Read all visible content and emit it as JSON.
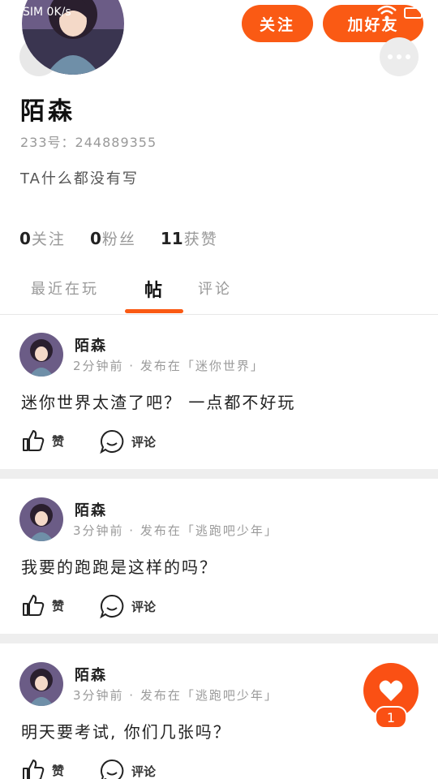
{
  "status_bar": {
    "left_text": "SIM 0K/s"
  },
  "header": {
    "follow_label": "关注",
    "add_friend_label": "加好友"
  },
  "profile": {
    "name": "陌森",
    "id_label": "233号：",
    "id_value": "244889355",
    "bio": "TA什么都没有写",
    "stats": [
      {
        "value": "0",
        "label": "关注"
      },
      {
        "value": "0",
        "label": "粉丝"
      },
      {
        "value": "11",
        "label": "获赞"
      }
    ]
  },
  "tabs": [
    {
      "label": "最近在玩",
      "active": false
    },
    {
      "label": "帖",
      "active": true
    },
    {
      "label": "评论",
      "active": false
    }
  ],
  "posts": [
    {
      "author": "陌森",
      "meta": "2分钟前 · 发布在「迷你世界」",
      "text": "迷你世界太渣了吧？ 一点都不好玩",
      "like_label": "赞",
      "comment_label": "评论"
    },
    {
      "author": "陌森",
      "meta": "3分钟前 · 发布在「逃跑吧少年」",
      "text": "我要的跑跑是这样的吗？",
      "like_label": "赞",
      "comment_label": "评论"
    },
    {
      "author": "陌森",
      "meta": "3分钟前 · 发布在「逃跑吧少年」",
      "text": "明天要考试, 你们几张吗？",
      "like_label": "赞",
      "comment_label": "评论"
    }
  ],
  "fab": {
    "count": "1",
    "icon": "heart-icon"
  },
  "colors": {
    "accent": "#fa5a14",
    "separator": "#eeeeee"
  }
}
